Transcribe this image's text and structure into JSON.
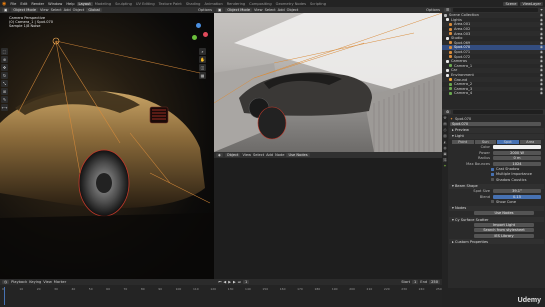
{
  "topbar": {
    "menus": [
      "File",
      "Edit",
      "Render",
      "Window",
      "Help"
    ],
    "workspaces": [
      "Layout",
      "Modeling",
      "Sculpting",
      "UV Editing",
      "Texture Paint",
      "Shading",
      "Animation",
      "Rendering",
      "Compositing",
      "Geometry Nodes",
      "Scripting"
    ],
    "active_workspace": "Layout",
    "scene_label": "Scene",
    "view_layer_label": "ViewLayer"
  },
  "main_viewport": {
    "mode": "Object Mode",
    "menus": [
      "View",
      "Select",
      "Add",
      "Object"
    ],
    "orientation": "Global",
    "options_label": "Options",
    "info_lines": [
      "Camera Perspective",
      "(0) Camera_1 | Spot.070",
      "Sample 1/8 Noise"
    ],
    "accent_color": "#d98c3b"
  },
  "right_viewport": {
    "mode": "Object Mode",
    "menus": [
      "View",
      "Select",
      "Add",
      "Object"
    ],
    "options_label": "Options"
  },
  "lower_editor": {
    "type_label": "Object",
    "menus": [
      "View",
      "Select",
      "Add",
      "Node"
    ],
    "use_nodes_label": "Use Nodes"
  },
  "outliner": {
    "search_placeholder": "",
    "rows": [
      "Scene Collection",
      "Lights",
      "Area.001",
      "Area.002",
      "Area.003",
      "Studio",
      "Spot.069",
      "Spot.070",
      "Spot.071",
      "Spot.072",
      "Cameras",
      "Camera_1",
      "Car",
      "Environment",
      "Ground",
      "Camera_2",
      "Camera_3",
      "Camera_4"
    ]
  },
  "properties": {
    "object_name": "Spot.070",
    "data_name": "Spot.070",
    "tabs": [
      "Point",
      "Sun",
      "Spot",
      "Area"
    ],
    "active_tab": "Spot",
    "sections": {
      "preview": "Preview",
      "light": "Light",
      "beam_shape": "Beam Shape",
      "nodes": "Nodes",
      "custom_properties": "Custom Properties",
      "cycles_settings": "Cy Surface Scatter"
    },
    "fields": [
      {
        "label": "Color",
        "value": ""
      },
      {
        "label": "Power",
        "value": "2000 W"
      },
      {
        "label": "Radius",
        "value": "0 m"
      },
      {
        "label": "Max Bounces",
        "value": "1024"
      }
    ],
    "checkboxes": [
      {
        "label": "Cast Shadow",
        "checked": true
      },
      {
        "label": "Multiple Importance",
        "checked": true
      },
      {
        "label": "Shadow Caustics",
        "checked": false
      }
    ],
    "beam_fields": [
      {
        "label": "Spot Size",
        "value": "39.1°",
        "highlight": false
      },
      {
        "label": "Blend",
        "value": "0.15",
        "highlight": true
      }
    ],
    "show_cone_label": "Show Cone",
    "use_nodes_button": "Use Nodes",
    "extra_buttons": [
      "Import Light",
      "Search from stylesheet",
      "IES Library"
    ]
  },
  "timeline": {
    "menus": [
      "Playback",
      "Keying",
      "View",
      "Marker"
    ],
    "frame_current": "1",
    "start_label": "Start",
    "start_value": "1",
    "end_label": "End",
    "end_value": "250",
    "ticks": [
      "0",
      "10",
      "20",
      "30",
      "40",
      "50",
      "60",
      "70",
      "80",
      "90",
      "100",
      "110",
      "120",
      "130",
      "140",
      "150",
      "160",
      "170",
      "180",
      "190",
      "200",
      "210",
      "220",
      "230",
      "240",
      "250"
    ]
  },
  "watermark": "Udemy"
}
